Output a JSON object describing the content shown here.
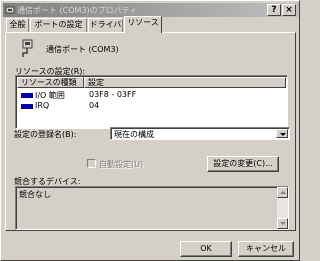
{
  "window": {
    "title": "通信ポート (COM3)のプロパティ",
    "help_label": "?",
    "close_label": "×"
  },
  "tabs": [
    {
      "label": "全般"
    },
    {
      "label": "ポートの設定"
    },
    {
      "label": "ドライバ"
    },
    {
      "label": "リソース"
    }
  ],
  "device": {
    "icon": "port-device-icon",
    "name": "通信ポート (COM3)"
  },
  "resources": {
    "label": "リソースの設定(R):",
    "columns": [
      "リソースの種類",
      "設定"
    ],
    "rows": [
      {
        "icon": "resource-io-icon",
        "type": "I/O 範囲",
        "setting": "03F8 - 03FF"
      },
      {
        "icon": "resource-irq-icon",
        "type": "IRQ",
        "setting": "04"
      }
    ]
  },
  "config": {
    "label": "設定の登録名(B):",
    "value": "現在の構成"
  },
  "auto_setting": {
    "label": "自動設定(U)",
    "checked": false
  },
  "change_setting_label": "設定の変更(C)...",
  "conflict": {
    "label": "競合するデバイス:",
    "text": "競合なし"
  },
  "ok_label": "OK",
  "cancel_label": "キャンセル",
  "colors": {
    "face": "#d4d0c8",
    "title_start": "#7f7f7f",
    "title_end": "#c0c0c0",
    "resource_icon": "#0000c0"
  }
}
